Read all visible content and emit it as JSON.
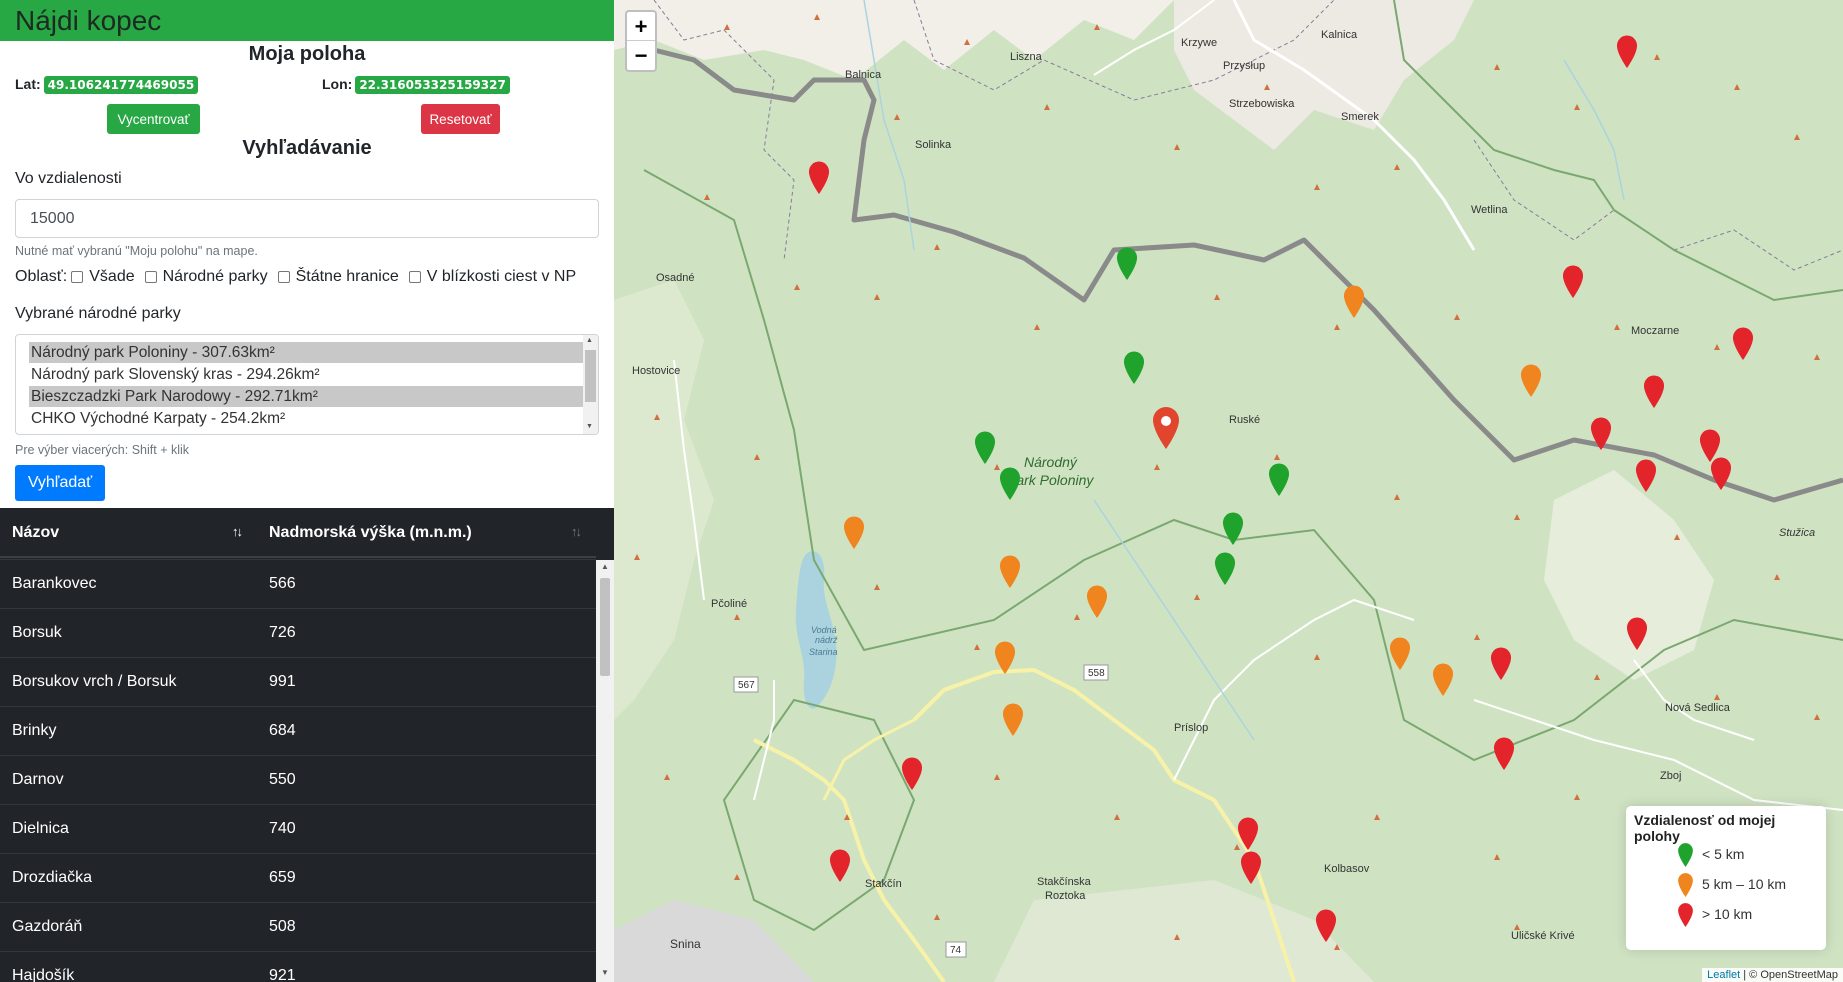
{
  "app": {
    "title": "Nájdi kopec"
  },
  "location": {
    "heading": "Moja poloha",
    "lat_label": "Lat:",
    "lat_value": "49.106241774469055",
    "lon_label": "Lon:",
    "lon_value": "22.316053325159327",
    "center_button": "Vycentrovať",
    "reset_button": "Resetovať"
  },
  "search": {
    "heading": "Vyhľadávanie",
    "distance_label": "Vo vzdialenosti",
    "distance_value": "15000",
    "hint": "Nutné mať vybranú \"Moju polohu\" na mape.",
    "area_label": "Oblasť:",
    "area_options": [
      "Všade",
      "Národné parky",
      "Štátne hranice",
      "V blízkosti ciest v NP"
    ],
    "parks_label": "Vybrané národné parky",
    "parks": [
      {
        "label": "Národný park Poloniny - 307.63km²",
        "selected": true
      },
      {
        "label": "Národný park Slovenský kras - 294.26km²",
        "selected": false
      },
      {
        "label": "Bieszczadzki Park Narodowy - 292.71km²",
        "selected": true
      },
      {
        "label": "CHKO Východné Karpaty - 254.2km²",
        "selected": false
      }
    ],
    "multi_hint": "Pre výber viacerých: Shift + klik",
    "submit_button": "Vyhľadať"
  },
  "table": {
    "headers": [
      "Názov",
      "Nadmorská výška (m.n.m.)"
    ],
    "rows": [
      [
        "Barankovec",
        "566"
      ],
      [
        "Borsuk",
        "726"
      ],
      [
        "Borsukov vrch / Borsuk",
        "991"
      ],
      [
        "Brinky",
        "684"
      ],
      [
        "Darnov",
        "550"
      ],
      [
        "Dielnica",
        "740"
      ],
      [
        "Drozdiačka",
        "659"
      ],
      [
        "Gazdoráň",
        "508"
      ],
      [
        "Hajdošík",
        "921"
      ]
    ]
  },
  "map": {
    "zoom_in": "+",
    "zoom_out": "−",
    "place_labels": [
      {
        "text": "Kalnica"
      },
      {
        "text": "Krzywe"
      },
      {
        "text": "Liszna"
      },
      {
        "text": "Przysłup"
      },
      {
        "text": "Balnica"
      },
      {
        "text": "Strzebowiska"
      },
      {
        "text": "Smerek"
      },
      {
        "text": "Solinka"
      },
      {
        "text": "Wetlina"
      },
      {
        "text": "Osadné"
      },
      {
        "text": "Moczarne"
      },
      {
        "text": "Hostovice"
      },
      {
        "text": "Ruské"
      },
      {
        "text": "Národný"
      },
      {
        "text": "Park Poloniny"
      },
      {
        "text": "Stužica"
      },
      {
        "text": "Pčoliné"
      },
      {
        "text": "Vodná"
      },
      {
        "text": "nádrž"
      },
      {
        "text": "Starina"
      },
      {
        "text": "558"
      },
      {
        "text": "567"
      },
      {
        "text": "Príslop"
      },
      {
        "text": "Nová Sedlica"
      },
      {
        "text": "Zboj"
      },
      {
        "text": "Kolbasov"
      },
      {
        "text": "Stakčín"
      },
      {
        "text": "Stakčínska"
      },
      {
        "text": "Roztoka"
      },
      {
        "text": "Snina"
      },
      {
        "text": "74"
      },
      {
        "text": "Uličské Krivé"
      }
    ],
    "colors": {
      "near": "#1fa32d",
      "mid": "#f0851f",
      "far": "#e3242b",
      "location": "#e2452e"
    },
    "legend": {
      "title": "Vzdialenosť od mojej polohy",
      "items": [
        {
          "label": "< 5 km",
          "color": "#1fa32d"
        },
        {
          "label": "5 km – 10 km",
          "color": "#f0851f"
        },
        {
          "label": "> 10 km",
          "color": "#e3242b"
        }
      ]
    },
    "attribution_link": "Leaflet",
    "attribution_text": "| © OpenStreetMap"
  }
}
